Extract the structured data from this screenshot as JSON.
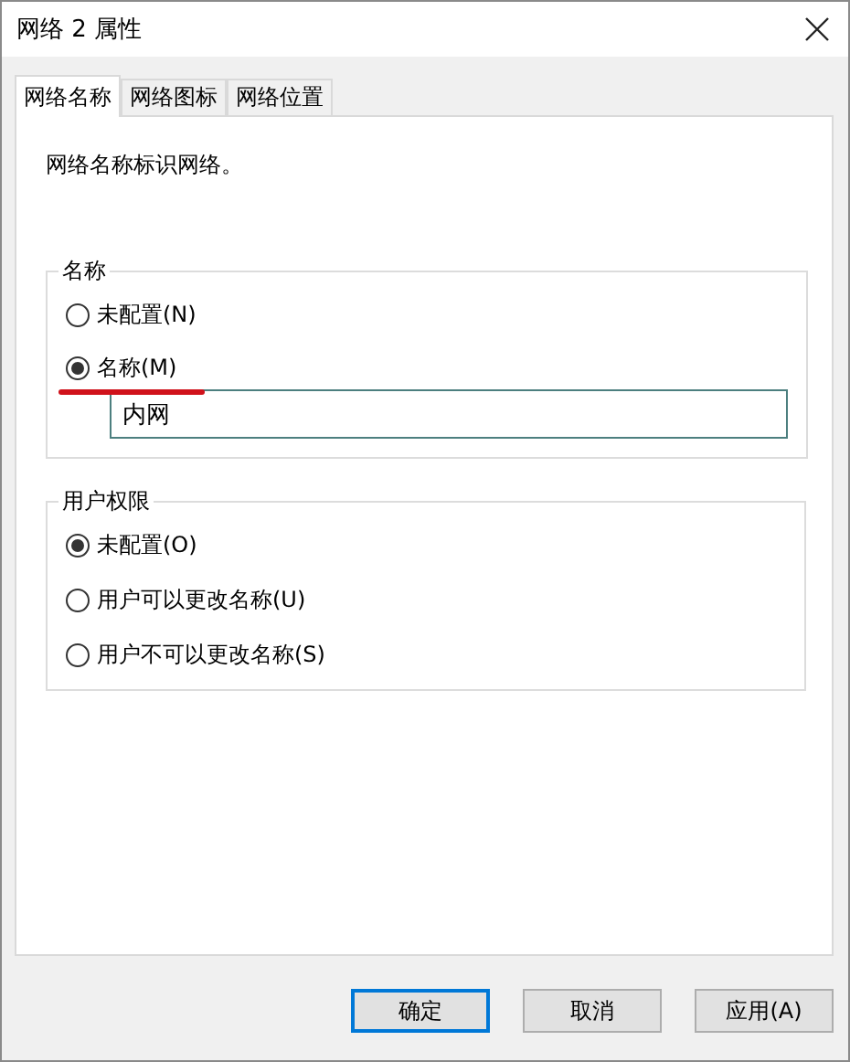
{
  "window": {
    "title": "网络 2 属性"
  },
  "tabs": [
    {
      "label": "网络名称",
      "selected": true
    },
    {
      "label": "网络图标",
      "selected": false
    },
    {
      "label": "网络位置",
      "selected": false
    }
  ],
  "description": "网络名称标识网络。",
  "name_group": {
    "title": "名称",
    "options": [
      {
        "label": "未配置(N)",
        "selected": false,
        "marked": false
      },
      {
        "label": "名称(M)",
        "selected": true,
        "marked": true
      }
    ],
    "field": {
      "value": "内网"
    }
  },
  "permission_group": {
    "title": "用户权限",
    "options": [
      {
        "label": "未配置(O)",
        "selected": true
      },
      {
        "label": "用户可以更改名称(U)",
        "selected": false
      },
      {
        "label": "用户不可以更改名称(S)",
        "selected": false
      }
    ]
  },
  "buttons": [
    {
      "label": "确定",
      "default": true
    },
    {
      "label": "取消",
      "default": false
    },
    {
      "label": "应用(A)",
      "default": false
    }
  ]
}
